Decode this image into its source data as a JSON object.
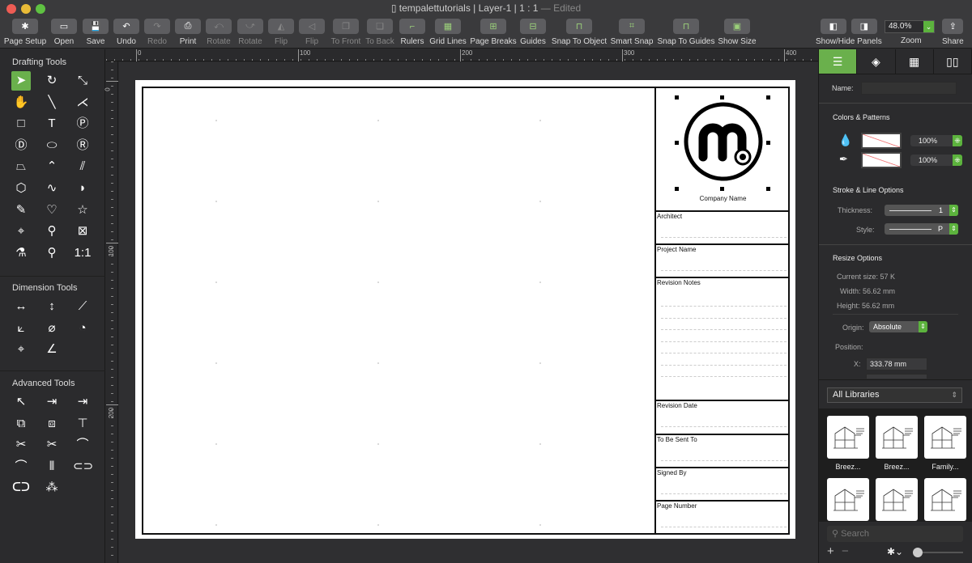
{
  "window": {
    "title": "tempalettutorials | Layer-1 | 1 : 1",
    "edited": "— Edited",
    "close_color": "#ee5c54",
    "min_color": "#e9bb37",
    "max_color": "#5fc242"
  },
  "toolbar": [
    {
      "label": "Page Setup",
      "icon": "gear-icon",
      "glyph": "✱"
    },
    {
      "label": "Open",
      "icon": "folder-icon",
      "glyph": "▭"
    },
    {
      "label": "Save",
      "icon": "floppy-icon",
      "glyph": "💾"
    },
    {
      "label": "Undo",
      "icon": "undo-icon",
      "glyph": "↶"
    },
    {
      "label": "Redo",
      "icon": "redo-icon",
      "glyph": "↷",
      "disabled": true
    },
    {
      "label": "Print",
      "icon": "printer-icon",
      "glyph": "⎙"
    },
    {
      "label": "Rotate",
      "icon": "rotate-left-icon",
      "glyph": "⤺",
      "disabled": true
    },
    {
      "label": "Rotate",
      "icon": "rotate-right-icon",
      "glyph": "⤻",
      "disabled": true
    },
    {
      "label": "Flip",
      "icon": "flip-horizontal-icon",
      "glyph": "◭",
      "disabled": true
    },
    {
      "label": "Flip",
      "icon": "flip-vertical-icon",
      "glyph": "◁",
      "disabled": true
    },
    {
      "label": "To Front",
      "icon": "to-front-icon",
      "glyph": "❐",
      "disabled": true
    },
    {
      "label": "To Back",
      "icon": "to-back-icon",
      "glyph": "❏",
      "disabled": true
    },
    {
      "label": "Rulers",
      "icon": "rulers-icon",
      "glyph": "⌐"
    },
    {
      "label": "Grid Lines",
      "icon": "grid-lines-icon",
      "glyph": "▦"
    },
    {
      "label": "Page Breaks",
      "icon": "page-breaks-icon",
      "glyph": "⊞"
    },
    {
      "label": "Guides",
      "icon": "guides-icon",
      "glyph": "⊟"
    },
    {
      "label": "Snap To Object",
      "icon": "snap-object-icon",
      "glyph": "⊓"
    },
    {
      "label": "Smart Snap",
      "icon": "smart-snap-icon",
      "glyph": "⌗"
    },
    {
      "label": "Snap To Guides",
      "icon": "snap-guides-icon",
      "glyph": "⊓"
    },
    {
      "label": "Show Size",
      "icon": "show-size-icon",
      "glyph": "▣"
    }
  ],
  "panels_label": "Show/Hide Panels",
  "zoom": {
    "label": "Zoom",
    "value": "48.0%"
  },
  "share_label": "Share",
  "left": {
    "drafting": "Drafting Tools",
    "dimension": "Dimension Tools",
    "advanced": "Advanced Tools",
    "drafting_tools": [
      [
        "select",
        "➤"
      ],
      [
        "rotate",
        "↻"
      ],
      [
        "resize",
        "⤡"
      ],
      [
        "hand",
        "✋"
      ],
      [
        "line",
        "╲"
      ],
      [
        "multi-line",
        "⋌"
      ],
      [
        "rectangle",
        "□"
      ],
      [
        "text",
        "T"
      ],
      [
        "parking",
        "Ⓟ"
      ],
      [
        "circle-d",
        "Ⓓ"
      ],
      [
        "ellipse",
        "⬭"
      ],
      [
        "circle-r",
        "Ⓡ"
      ],
      [
        "polygon",
        "⏢"
      ],
      [
        "polyline",
        "⌃"
      ],
      [
        "parallel-lines",
        "⫽"
      ],
      [
        "hexagon",
        "⬡"
      ],
      [
        "curve",
        "∿"
      ],
      [
        "arc",
        "◗"
      ],
      [
        "pencil",
        "✎"
      ],
      [
        "freeform",
        "♡"
      ],
      [
        "star",
        "☆"
      ],
      [
        "crosshair",
        "⌖"
      ],
      [
        "stamp",
        "⚲"
      ],
      [
        "image",
        "⊠"
      ],
      [
        "eyedropper",
        "⚗"
      ],
      [
        "magnifier",
        "⚲"
      ],
      [
        "actual-size",
        "1:1"
      ]
    ],
    "dimension_tools": [
      [
        "horizontal-dimension",
        "↔"
      ],
      [
        "vertical-dimension",
        "↕"
      ],
      [
        "angled-dimension",
        "⟋"
      ],
      [
        "perpendicular-dimension",
        "⟀"
      ],
      [
        "diameter",
        "⌀"
      ],
      [
        "radius",
        "◔"
      ],
      [
        "center-mark",
        "⌖"
      ],
      [
        "angle",
        "∠"
      ]
    ],
    "advanced_tools": [
      [
        "node-select",
        "↖"
      ],
      [
        "extend",
        "⇥"
      ],
      [
        "extend-to",
        "⇥"
      ],
      [
        "union",
        "⧉"
      ],
      [
        "subtract",
        "⧈"
      ],
      [
        "trim",
        "⊤"
      ],
      [
        "scissors",
        "✂"
      ],
      [
        "multi-scissors",
        "✂"
      ],
      [
        "fillet",
        "⌒"
      ],
      [
        "chamfer",
        "⌒"
      ],
      [
        "mirror",
        "⫴"
      ],
      [
        "join",
        "⊂⊃"
      ],
      [
        "break",
        "ᑕᑐ"
      ],
      [
        "spring",
        "⁂"
      ]
    ]
  },
  "rulers": {
    "h": [
      "0",
      "100",
      "200",
      "300",
      "400"
    ],
    "v": [
      "0",
      "100",
      "200"
    ]
  },
  "title_block": {
    "company": "Company Name",
    "rows": [
      "Architect",
      "Project Name",
      "Revision Notes",
      "Revision Date",
      "To Be Sent To",
      "Signed By",
      "Page Number"
    ]
  },
  "right": {
    "tabs": [
      "properties-icon",
      "layers-icon",
      "grid-icon",
      "library-icon"
    ],
    "name_label": "Name:",
    "name_value": "",
    "colors_header": "Colors & Patterns",
    "fill_opacity": "100%",
    "stroke_opacity": "100%",
    "stroke_header": "Stroke & Line Options",
    "thickness_label": "Thickness:",
    "thickness_value": "1",
    "style_label": "Style:",
    "style_value": "P",
    "resize_header": "Resize Options",
    "current_size_label": "Current size:",
    "current_size": "57 K",
    "width_label": "Width:",
    "width": "56.62 mm",
    "height_label": "Height:",
    "height": "56.62 mm",
    "origin_label": "Origin:",
    "origin": "Absolute",
    "position_label": "Position:",
    "x_label": "X:",
    "x": "333.78 mm",
    "library": "All Libraries",
    "thumbs": [
      "Breez...",
      "Breez...",
      "Family...",
      "",
      "",
      ""
    ],
    "search_placeholder": "Search"
  },
  "accent": "#6ab04c"
}
